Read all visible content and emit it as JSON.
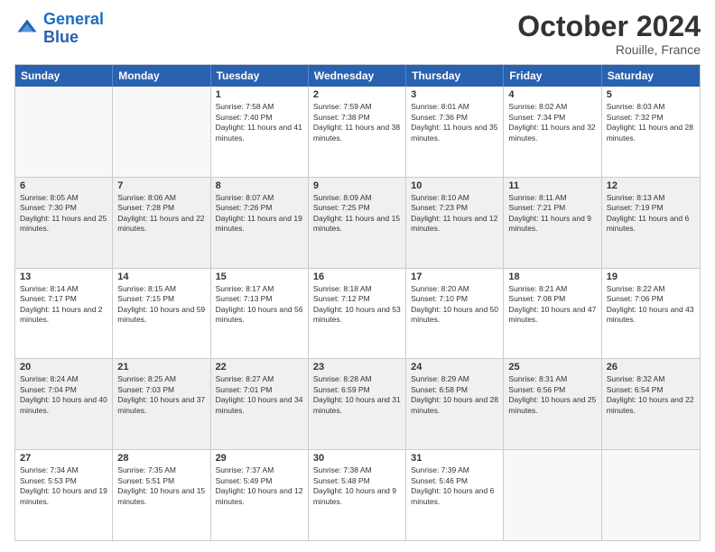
{
  "header": {
    "logo_line1": "General",
    "logo_line2": "Blue",
    "month": "October 2024",
    "location": "Rouille, France"
  },
  "days_of_week": [
    "Sunday",
    "Monday",
    "Tuesday",
    "Wednesday",
    "Thursday",
    "Friday",
    "Saturday"
  ],
  "rows": [
    [
      {
        "day": "",
        "info": ""
      },
      {
        "day": "",
        "info": ""
      },
      {
        "day": "1",
        "info": "Sunrise: 7:58 AM\nSunset: 7:40 PM\nDaylight: 11 hours and 41 minutes."
      },
      {
        "day": "2",
        "info": "Sunrise: 7:59 AM\nSunset: 7:38 PM\nDaylight: 11 hours and 38 minutes."
      },
      {
        "day": "3",
        "info": "Sunrise: 8:01 AM\nSunset: 7:36 PM\nDaylight: 11 hours and 35 minutes."
      },
      {
        "day": "4",
        "info": "Sunrise: 8:02 AM\nSunset: 7:34 PM\nDaylight: 11 hours and 32 minutes."
      },
      {
        "day": "5",
        "info": "Sunrise: 8:03 AM\nSunset: 7:32 PM\nDaylight: 11 hours and 28 minutes."
      }
    ],
    [
      {
        "day": "6",
        "info": "Sunrise: 8:05 AM\nSunset: 7:30 PM\nDaylight: 11 hours and 25 minutes."
      },
      {
        "day": "7",
        "info": "Sunrise: 8:06 AM\nSunset: 7:28 PM\nDaylight: 11 hours and 22 minutes."
      },
      {
        "day": "8",
        "info": "Sunrise: 8:07 AM\nSunset: 7:26 PM\nDaylight: 11 hours and 19 minutes."
      },
      {
        "day": "9",
        "info": "Sunrise: 8:09 AM\nSunset: 7:25 PM\nDaylight: 11 hours and 15 minutes."
      },
      {
        "day": "10",
        "info": "Sunrise: 8:10 AM\nSunset: 7:23 PM\nDaylight: 11 hours and 12 minutes."
      },
      {
        "day": "11",
        "info": "Sunrise: 8:11 AM\nSunset: 7:21 PM\nDaylight: 11 hours and 9 minutes."
      },
      {
        "day": "12",
        "info": "Sunrise: 8:13 AM\nSunset: 7:19 PM\nDaylight: 11 hours and 6 minutes."
      }
    ],
    [
      {
        "day": "13",
        "info": "Sunrise: 8:14 AM\nSunset: 7:17 PM\nDaylight: 11 hours and 2 minutes."
      },
      {
        "day": "14",
        "info": "Sunrise: 8:15 AM\nSunset: 7:15 PM\nDaylight: 10 hours and 59 minutes."
      },
      {
        "day": "15",
        "info": "Sunrise: 8:17 AM\nSunset: 7:13 PM\nDaylight: 10 hours and 56 minutes."
      },
      {
        "day": "16",
        "info": "Sunrise: 8:18 AM\nSunset: 7:12 PM\nDaylight: 10 hours and 53 minutes."
      },
      {
        "day": "17",
        "info": "Sunrise: 8:20 AM\nSunset: 7:10 PM\nDaylight: 10 hours and 50 minutes."
      },
      {
        "day": "18",
        "info": "Sunrise: 8:21 AM\nSunset: 7:08 PM\nDaylight: 10 hours and 47 minutes."
      },
      {
        "day": "19",
        "info": "Sunrise: 8:22 AM\nSunset: 7:06 PM\nDaylight: 10 hours and 43 minutes."
      }
    ],
    [
      {
        "day": "20",
        "info": "Sunrise: 8:24 AM\nSunset: 7:04 PM\nDaylight: 10 hours and 40 minutes."
      },
      {
        "day": "21",
        "info": "Sunrise: 8:25 AM\nSunset: 7:03 PM\nDaylight: 10 hours and 37 minutes."
      },
      {
        "day": "22",
        "info": "Sunrise: 8:27 AM\nSunset: 7:01 PM\nDaylight: 10 hours and 34 minutes."
      },
      {
        "day": "23",
        "info": "Sunrise: 8:28 AM\nSunset: 6:59 PM\nDaylight: 10 hours and 31 minutes."
      },
      {
        "day": "24",
        "info": "Sunrise: 8:29 AM\nSunset: 6:58 PM\nDaylight: 10 hours and 28 minutes."
      },
      {
        "day": "25",
        "info": "Sunrise: 8:31 AM\nSunset: 6:56 PM\nDaylight: 10 hours and 25 minutes."
      },
      {
        "day": "26",
        "info": "Sunrise: 8:32 AM\nSunset: 6:54 PM\nDaylight: 10 hours and 22 minutes."
      }
    ],
    [
      {
        "day": "27",
        "info": "Sunrise: 7:34 AM\nSunset: 5:53 PM\nDaylight: 10 hours and 19 minutes."
      },
      {
        "day": "28",
        "info": "Sunrise: 7:35 AM\nSunset: 5:51 PM\nDaylight: 10 hours and 15 minutes."
      },
      {
        "day": "29",
        "info": "Sunrise: 7:37 AM\nSunset: 5:49 PM\nDaylight: 10 hours and 12 minutes."
      },
      {
        "day": "30",
        "info": "Sunrise: 7:38 AM\nSunset: 5:48 PM\nDaylight: 10 hours and 9 minutes."
      },
      {
        "day": "31",
        "info": "Sunrise: 7:39 AM\nSunset: 5:46 PM\nDaylight: 10 hours and 6 minutes."
      },
      {
        "day": "",
        "info": ""
      },
      {
        "day": "",
        "info": ""
      }
    ]
  ]
}
